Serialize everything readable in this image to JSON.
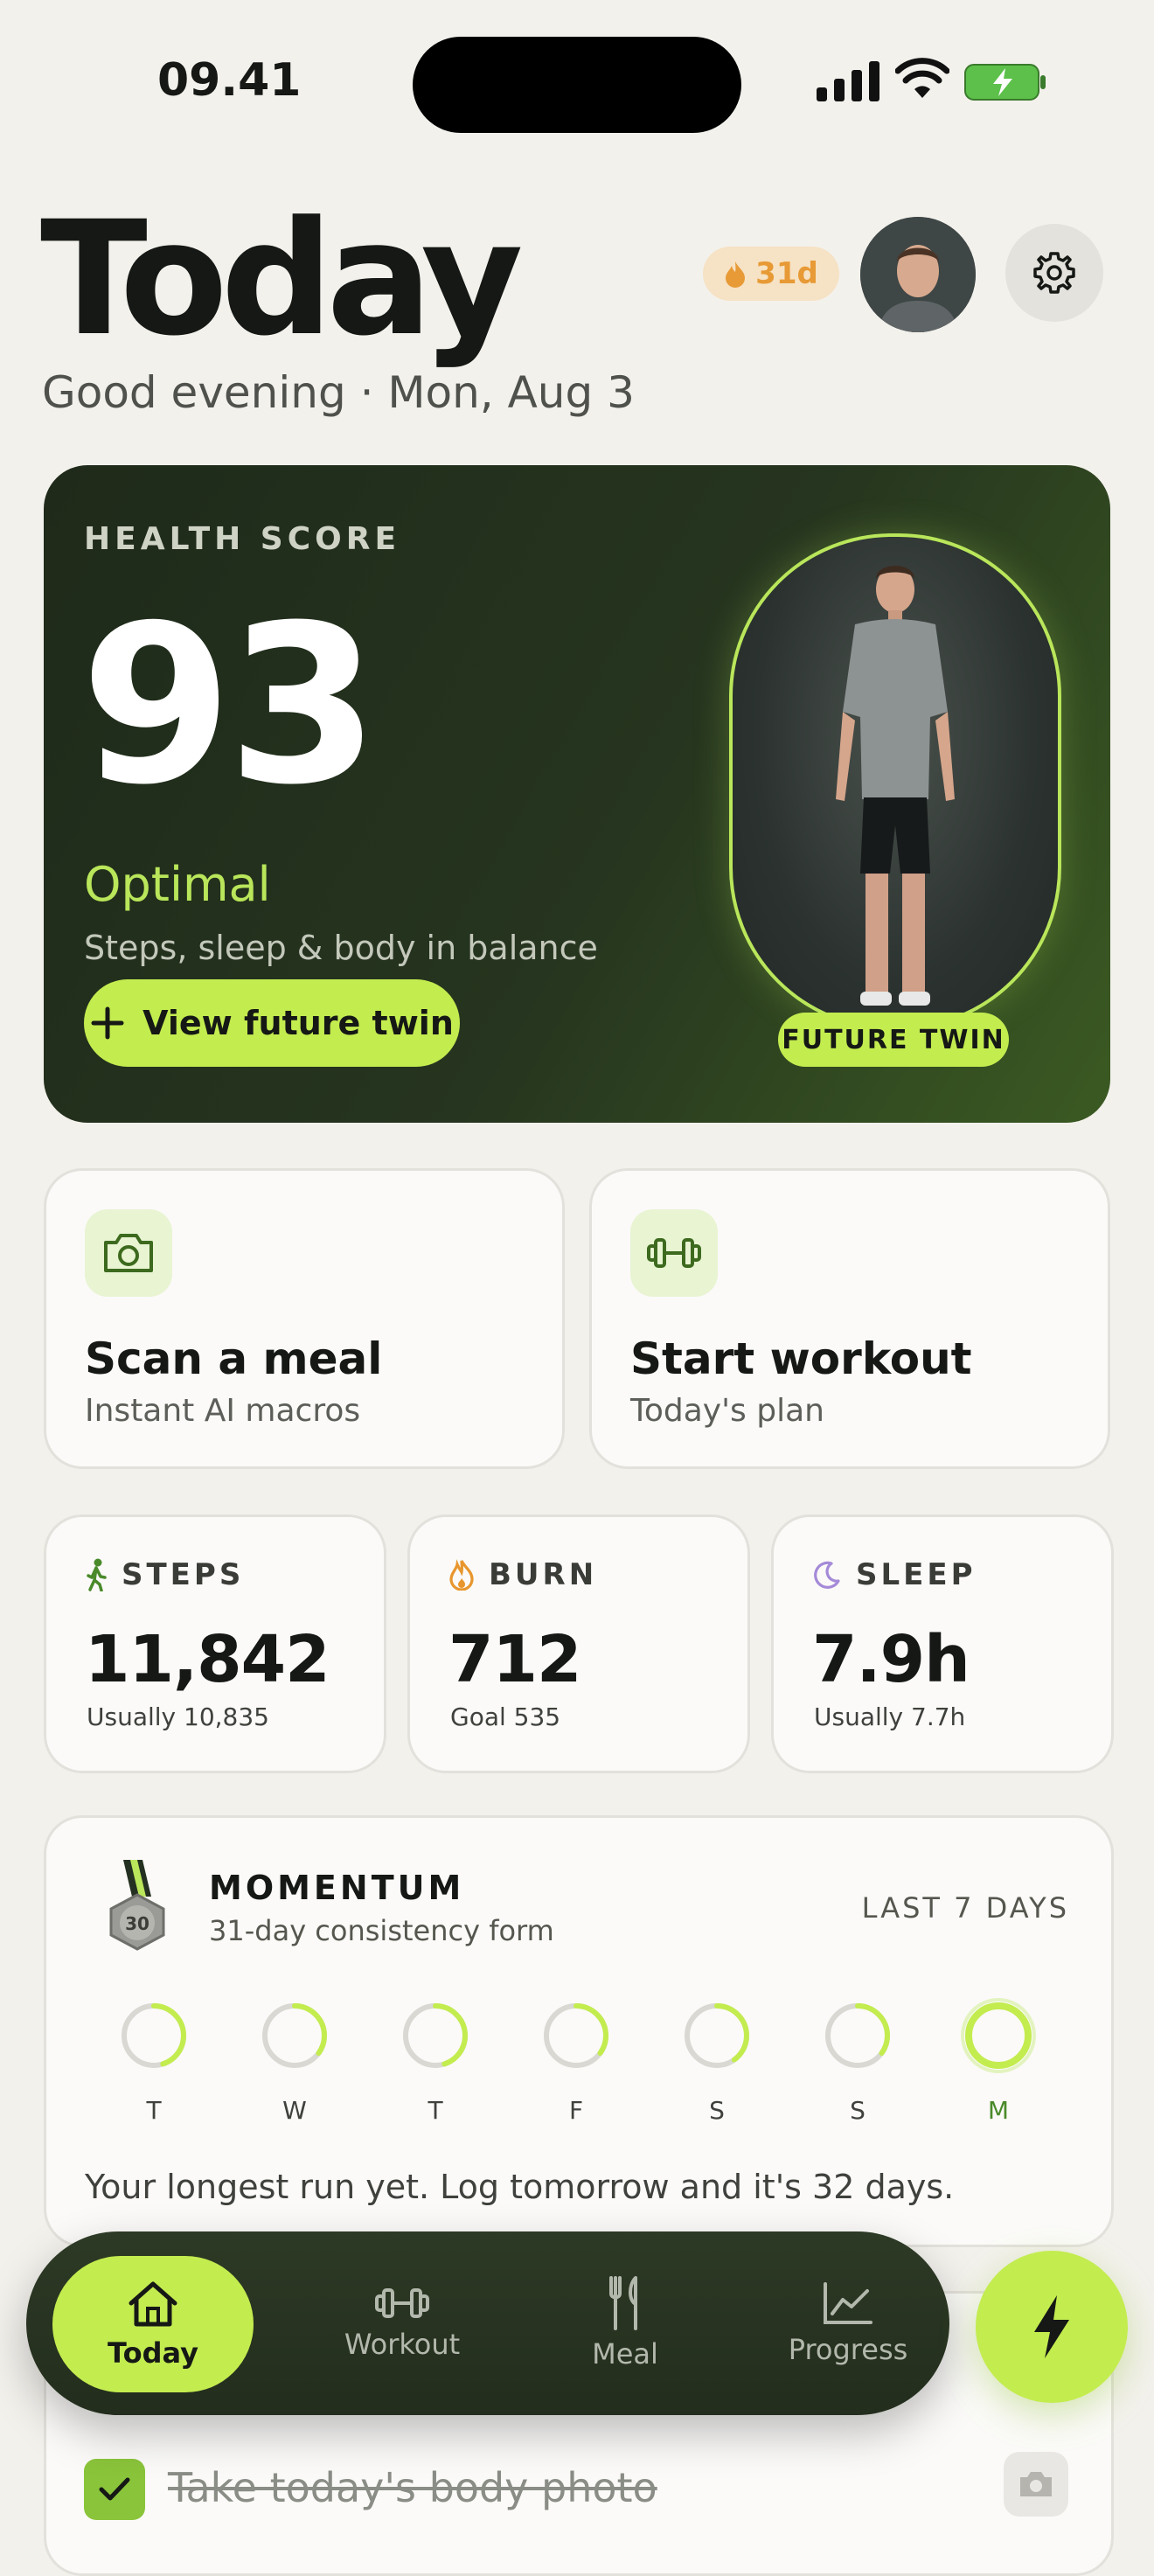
{
  "status_bar": {
    "time": "09.41"
  },
  "header": {
    "title": "Today",
    "subtitle": "Good evening · Mon, Aug 3",
    "streak": "31d"
  },
  "health": {
    "label": "HEALTH SCORE",
    "score": "93",
    "status": "Optimal",
    "description": "Steps, sleep & body in balance",
    "button_label": "View future twin",
    "twin_badge": "FUTURE TWIN"
  },
  "actions": [
    {
      "title": "Scan a meal",
      "subtitle": "Instant AI macros",
      "icon": "camera-icon"
    },
    {
      "title": "Start workout",
      "subtitle": "Today's plan",
      "icon": "dumbbell-icon"
    }
  ],
  "metrics": [
    {
      "label": "STEPS",
      "value": "11,842",
      "sub": "Usually 10,835",
      "icon": "walking-icon",
      "color": "#4a8a2a"
    },
    {
      "label": "BURN",
      "value": "712",
      "sub": "Goal 535",
      "icon": "flame-icon",
      "color": "#e8962e"
    },
    {
      "label": "SLEEP",
      "value": "7.9h",
      "sub": "Usually 7.7h",
      "icon": "moon-icon",
      "color": "#a58ad8"
    }
  ],
  "momentum": {
    "title": "MOMENTUM",
    "subtitle": "31-day consistency form",
    "range": "LAST 7 DAYS",
    "medal_text": "30",
    "footer": "Your longest run yet. Log tomorrow and it's 32 days.",
    "days": [
      {
        "label": "T",
        "progress": 0.45
      },
      {
        "label": "W",
        "progress": 0.35
      },
      {
        "label": "T",
        "progress": 0.45
      },
      {
        "label": "F",
        "progress": 0.35
      },
      {
        "label": "S",
        "progress": 0.4
      },
      {
        "label": "S",
        "progress": 0.35
      },
      {
        "label": "M",
        "progress": 1.0
      }
    ]
  },
  "task": {
    "text": "Take today's body photo"
  },
  "nav": {
    "items": [
      {
        "label": "Today"
      },
      {
        "label": "Workout"
      },
      {
        "label": "Meal"
      },
      {
        "label": "Progress"
      }
    ]
  },
  "colors": {
    "accent": "#c3ec4f",
    "dark_card": "#26351f",
    "background": "#f3f1ec"
  }
}
